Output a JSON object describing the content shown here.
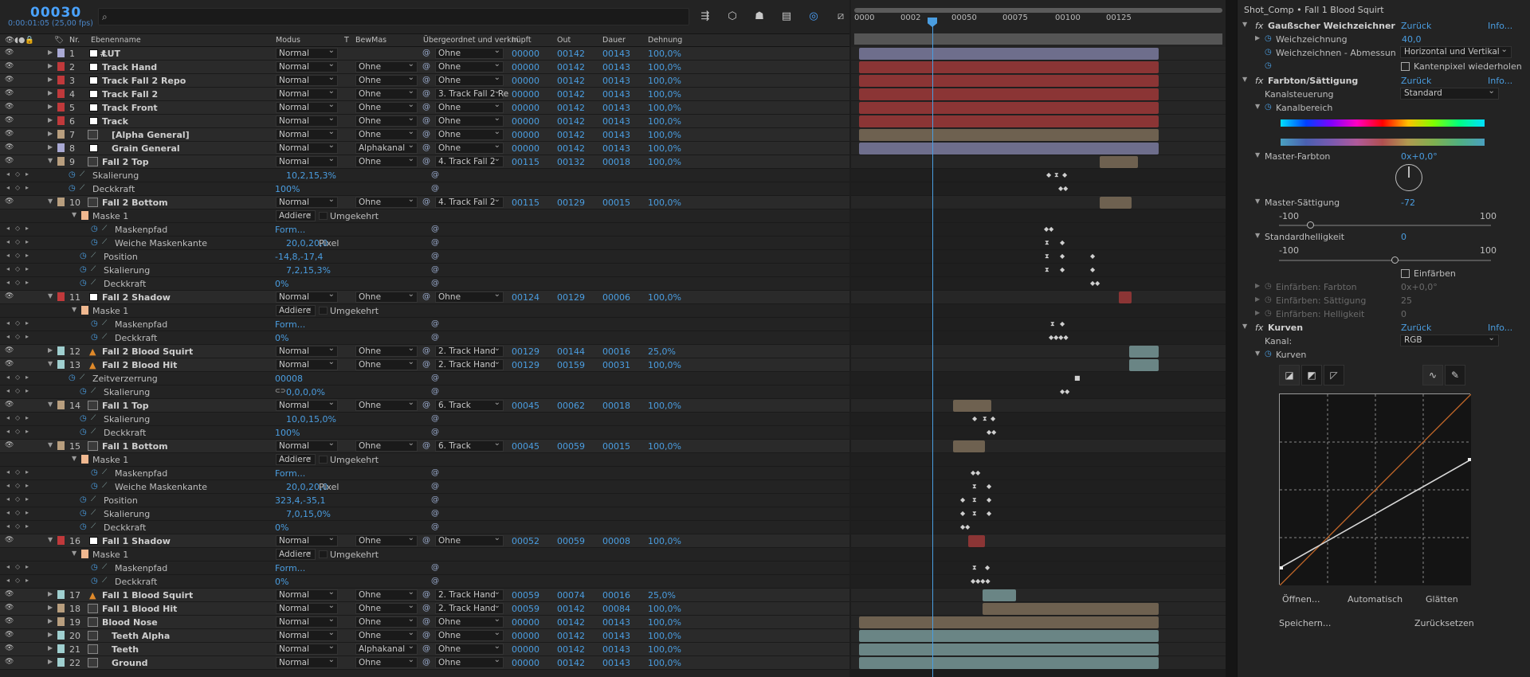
{
  "timecode": "00030",
  "fps": "0:00:01:05 (25,00 fps)",
  "search": {
    "placeholder": ""
  },
  "columns": {
    "nr": "Nr.",
    "name": "Ebenenname",
    "mode": "Modus",
    "t": "T",
    "trkmat": "BewMas",
    "parent": "Übergeordnet und verknüpft",
    "in": "In",
    "out": "Out",
    "dur": "Dauer",
    "stretch": "Dehnung"
  },
  "ruler": {
    "ticks": [
      "0000",
      "0002",
      "00050",
      "00075",
      "00100",
      "00125"
    ]
  },
  "layers_data": [
    {
      "nr": "1",
      "name": "LUT",
      "mode": "Normal",
      "trkmat": "",
      "parent": "Ohne",
      "in": "00000",
      "out": "00142",
      "dur": "00143",
      "stretch": "100,0%",
      "label": "#a9a9d4",
      "type": "adj"
    },
    {
      "nr": "2",
      "name": "Track Hand",
      "mode": "Normal",
      "trkmat": "Ohne",
      "parent": "Ohne",
      "in": "00000",
      "out": "00142",
      "dur": "00143",
      "stretch": "100,0%",
      "label": "#c0393b",
      "type": "solid"
    },
    {
      "nr": "3",
      "name": "Track Fall 2 Repo",
      "mode": "Normal",
      "trkmat": "Ohne",
      "parent": "Ohne",
      "in": "00000",
      "out": "00142",
      "dur": "00143",
      "stretch": "100,0%",
      "label": "#c0393b",
      "type": "solid"
    },
    {
      "nr": "4",
      "name": "Track Fall 2",
      "mode": "Normal",
      "trkmat": "Ohne",
      "parent": "3. Track Fall 2 Re",
      "in": "00000",
      "out": "00142",
      "dur": "00143",
      "stretch": "100,0%",
      "label": "#c0393b",
      "type": "solid"
    },
    {
      "nr": "5",
      "name": "Track Front",
      "mode": "Normal",
      "trkmat": "Ohne",
      "parent": "Ohne",
      "in": "00000",
      "out": "00142",
      "dur": "00143",
      "stretch": "100,0%",
      "label": "#c0393b",
      "type": "solid"
    },
    {
      "nr": "6",
      "name": "Track",
      "mode": "Normal",
      "trkmat": "Ohne",
      "parent": "Ohne",
      "in": "00000",
      "out": "00142",
      "dur": "00143",
      "stretch": "100,0%",
      "label": "#c0393b",
      "type": "solid"
    },
    {
      "nr": "7",
      "name": "[Alpha General]",
      "mode": "Normal",
      "trkmat": "Ohne",
      "parent": "Ohne",
      "in": "00000",
      "out": "00142",
      "dur": "00143",
      "stretch": "100,0%",
      "label": "#b89e7e",
      "type": "comp"
    },
    {
      "nr": "8",
      "name": "Grain General",
      "mode": "Normal",
      "trkmat": "Alphakanal",
      "parent": "Ohne",
      "in": "00000",
      "out": "00142",
      "dur": "00143",
      "stretch": "100,0%",
      "label": "#a9a9d4",
      "type": "solid"
    },
    {
      "nr": "9",
      "name": "Fall 2 Top",
      "mode": "Normal",
      "trkmat": "Ohne",
      "parent": "4. Track Fall 2",
      "in": "00115",
      "out": "00132",
      "dur": "00018",
      "stretch": "100,0%",
      "label": "#b89e7e",
      "type": "comp"
    },
    {
      "nr": "10",
      "name": "Fall 2 Bottom",
      "mode": "Normal",
      "trkmat": "Ohne",
      "parent": "4. Track Fall 2",
      "in": "00115",
      "out": "00129",
      "dur": "00015",
      "stretch": "100,0%",
      "label": "#b89e7e",
      "type": "comp"
    },
    {
      "nr": "11",
      "name": "Fall 2 Shadow",
      "mode": "Normal",
      "trkmat": "Ohne",
      "parent": "Ohne",
      "in": "00124",
      "out": "00129",
      "dur": "00006",
      "stretch": "100,0%",
      "label": "#c0393b",
      "type": "solid"
    },
    {
      "nr": "12",
      "name": "Fall 2 Blood Squirt",
      "mode": "Normal",
      "trkmat": "Ohne",
      "parent": "2. Track Hand",
      "in": "00129",
      "out": "00144",
      "dur": "00016",
      "stretch": "25,0%",
      "label": "#9fcfcf",
      "type": "cone"
    },
    {
      "nr": "13",
      "name": "Fall 2 Blood Hit",
      "mode": "Normal",
      "trkmat": "Ohne",
      "parent": "2. Track Hand",
      "in": "00129",
      "out": "00159",
      "dur": "00031",
      "stretch": "100,0%",
      "label": "#9fcfcf",
      "type": "cone"
    },
    {
      "nr": "14",
      "name": "Fall 1 Top",
      "mode": "Normal",
      "trkmat": "Ohne",
      "parent": "6. Track",
      "in": "00045",
      "out": "00062",
      "dur": "00018",
      "stretch": "100,0%",
      "label": "#b89e7e",
      "type": "comp"
    },
    {
      "nr": "15",
      "name": "Fall 1 Bottom",
      "mode": "Normal",
      "trkmat": "Ohne",
      "parent": "6. Track",
      "in": "00045",
      "out": "00059",
      "dur": "00015",
      "stretch": "100,0%",
      "label": "#b89e7e",
      "type": "comp"
    },
    {
      "nr": "16",
      "name": "Fall 1 Shadow",
      "mode": "Normal",
      "trkmat": "Ohne",
      "parent": "Ohne",
      "in": "00052",
      "out": "00059",
      "dur": "00008",
      "stretch": "100,0%",
      "label": "#c0393b",
      "type": "solid"
    },
    {
      "nr": "17",
      "name": "Fall 1 Blood Squirt",
      "mode": "Normal",
      "trkmat": "Ohne",
      "parent": "2. Track Hand",
      "in": "00059",
      "out": "00074",
      "dur": "00016",
      "stretch": "25,0%",
      "label": "#9fcfcf",
      "type": "cone"
    },
    {
      "nr": "18",
      "name": "Fall 1 Blood Hit",
      "mode": "Normal",
      "trkmat": "Ohne",
      "parent": "2. Track Hand",
      "in": "00059",
      "out": "00142",
      "dur": "00084",
      "stretch": "100,0%",
      "label": "#b89e7e",
      "type": "comp"
    },
    {
      "nr": "19",
      "name": "Blood Nose",
      "mode": "Normal",
      "trkmat": "Ohne",
      "parent": "Ohne",
      "in": "00000",
      "out": "00142",
      "dur": "00143",
      "stretch": "100,0%",
      "label": "#b89e7e",
      "type": "comp"
    },
    {
      "nr": "20",
      "name": "Teeth Alpha",
      "mode": "Normal",
      "trkmat": "Ohne",
      "parent": "Ohne",
      "in": "00000",
      "out": "00142",
      "dur": "00143",
      "stretch": "100,0%",
      "label": "#9fcfcf",
      "type": "comp"
    },
    {
      "nr": "21",
      "name": "Teeth",
      "mode": "Normal",
      "trkmat": "Alphakanal",
      "parent": "Ohne",
      "in": "00000",
      "out": "00142",
      "dur": "00143",
      "stretch": "100,0%",
      "label": "#9fcfcf",
      "type": "comp"
    },
    {
      "nr": "22",
      "name": "Ground",
      "mode": "Normal",
      "trkmat": "Ohne",
      "parent": "Ohne",
      "in": "00000",
      "out": "00142",
      "dur": "00143",
      "stretch": "100,0%",
      "label": "#9fcfcf",
      "type": "comp"
    }
  ],
  "props": {
    "skalierung": "Skalierung",
    "deckkraft": "Deckkraft",
    "maske1": "Maske 1",
    "maskenpfad": "Maskenpfad",
    "weiche": "Weiche Maskenkante",
    "position": "Position",
    "zeitverzerrung": "Zeitverzerrung",
    "addiere": "Addiere",
    "umgekehrt": "Umgekehrt",
    "form": "Form...",
    "pixel": "Pixel"
  },
  "vals": {
    "l9_skal": "10,2,15,3%",
    "l9_deck": "100%",
    "l10_weiche": "20,0,20,0",
    "l10_pos": "-14,8,-17,4",
    "l10_skal": "7,2,15,3%",
    "l10_deck": "0%",
    "l11_deck": "0%",
    "l13_zeit": "00008",
    "l13_skal": "0,0,0,0%",
    "l14_skal": "10,0,15,0%",
    "l14_deck": "100%",
    "l15_weiche": "20,0,20,0",
    "l15_pos": "323,4,-35,1",
    "l15_skal": "7,0,15,0%",
    "l15_deck": "0%",
    "l16_deck": "0%"
  },
  "effects": {
    "title": "Shot_Comp • Fall 1 Blood Squirt",
    "gauss": "Gaußscher Weichzeichner",
    "reset": "Zurück",
    "info": "Info...",
    "weichzeichnung": "Weichzeichnung",
    "weichzeichnung_val": "40,0",
    "abmessung": "Weichzeichnen - Abmessun",
    "abmessung_val": "Horizontal und Vertikal",
    "kantenpixel": "Kantenpixel wiederholen",
    "farbton": "Farbton/Sättigung",
    "kanalsteuerung": "Kanalsteuerung",
    "kanalsteuerung_val": "Standard",
    "kanalbereich": "Kanalbereich",
    "master_farbton": "Master-Farbton",
    "master_farbton_val": "0x+0,0°",
    "master_sat": "Master-Sättigung",
    "master_sat_val": "-72",
    "min": "-100",
    "max": "100",
    "standardhell": "Standardhelligkeit",
    "standardhell_val": "0",
    "einfaerben": "Einfärben",
    "einf_farbton": "Einfärben: Farbton",
    "einf_farbton_val": "0x+0,0°",
    "einf_saett": "Einfärben: Sättigung",
    "einf_saett_val": "25",
    "einf_hell": "Einfärben: Helligkeit",
    "einf_hell_val": "0",
    "kurven": "Kurven",
    "kanal": "Kanal:",
    "kanal_val": "RGB",
    "kurven_sub": "Kurven",
    "oeffnen": "Öffnen...",
    "automatisch": "Automatisch",
    "glaetten": "Glätten",
    "speichern": "Speichern...",
    "zuruecksetzen": "Zurücksetzen"
  },
  "colors": {
    "accent": "#4a9de0",
    "red": "#c0393b",
    "tan": "#b89e7e",
    "lav": "#a9a9d4",
    "aqua": "#9fcfcf"
  }
}
